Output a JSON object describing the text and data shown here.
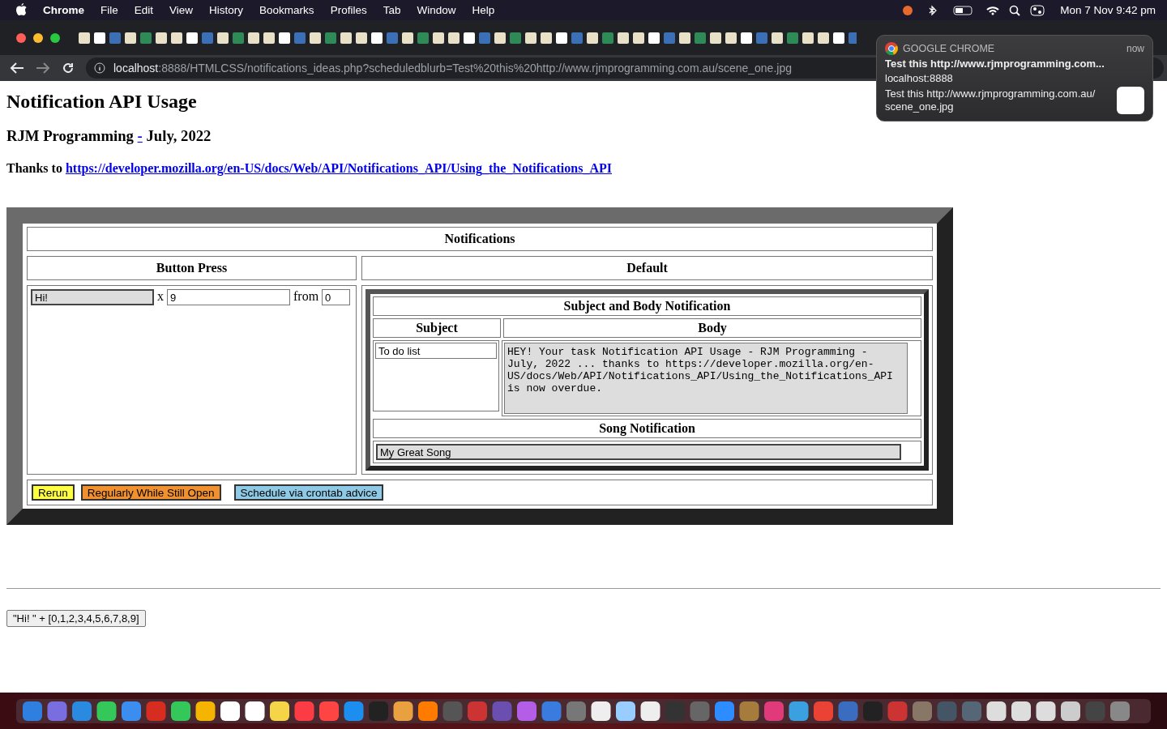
{
  "menu_bar": {
    "app": "Chrome",
    "menus": [
      "File",
      "Edit",
      "View",
      "History",
      "Bookmarks",
      "Profiles",
      "Tab",
      "Window",
      "Help"
    ],
    "clock": "Mon 7 Nov  9:42 pm"
  },
  "browser": {
    "url_host": "localhost",
    "url_rest": ":8888/HTMLCSS/notifications_ideas.php?scheduledblurb=Test%20this%20http://www.rjmprogramming.com.au/scene_one.jpg"
  },
  "notification": {
    "app": "GOOGLE CHROME",
    "time": "now",
    "title": "Test this http://www.rjmprogramming.com...",
    "source": "localhost:8888",
    "body": "Test this http://www.rjmprogramming.com.au/ scene_one.jpg"
  },
  "page": {
    "heading": "Notification API Usage",
    "byline": "RJM Programming",
    "byline_link": "-",
    "date": "July, 2022",
    "thanks_label": "Thanks to",
    "thanks_link": "https://developer.mozilla.org/en-US/docs/Web/API/Notifications_API/Using_the_Notifications_API"
  },
  "panel": {
    "title": "Notifications",
    "left_header": "Button Press",
    "right_header": "Default",
    "hi_value": "Hi!",
    "x_label": "x",
    "count_value": "9",
    "from_label": "from",
    "from_value": "0",
    "inner": {
      "title": "Subject and Body Notification",
      "subject_header": "Subject",
      "body_header": "Body",
      "subject_value": "To do list",
      "body_value": "HEY! Your task Notification API Usage - RJM Programming - July, 2022 ... thanks to https://developer.mozilla.org/en-US/docs/Web/API/Notifications_API/Using_the_Notifications_API is now overdue.",
      "song_title": "Song Notification",
      "song_value": "My Great Song"
    },
    "buttons": [
      {
        "label": "Rerun",
        "color": "#ffff44"
      },
      {
        "label": "Regularly While Still Open",
        "color": "#f0902f"
      },
      {
        "label": "Schedule via crontab advice",
        "color": "#8ecae6"
      }
    ]
  },
  "footer_button": "\"Hi! \" + [0,1,2,3,4,5,6,7,8,9]"
}
